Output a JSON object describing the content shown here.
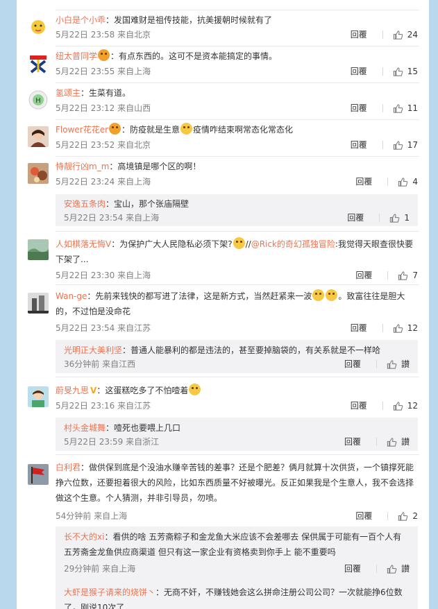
{
  "reply_label": "回覆",
  "comments": [
    {
      "user": "小白是个小乖",
      "text": "：发国难财是祖传技能，抗美援朝时候就有了",
      "time": "5月22日 23:58 来自北京",
      "likes": "24"
    },
    {
      "user": "纽太普同学",
      "text": "：有点东西的。这可不是资本能搞定的事情。",
      "time": "5月22日 23:55 来自上海",
      "likes": "15"
    },
    {
      "user": "氢颂主",
      "text": "：生菜有道。",
      "time": "5月22日 23:12 来自山西",
      "likes": "11"
    },
    {
      "user": "Flower花花er",
      "text_a": "：防疫就是生意",
      "text_b": "疫情咋结束啊常态化常态化",
      "time": "5月22日 23:52 来自北京",
      "likes": "17"
    },
    {
      "user": "恃靓行凶m_m",
      "text": "：高境镇是哪个区的啊！",
      "time": "5月22日 23:24 来自上海",
      "likes": "4",
      "reply": {
        "user": "安逸五条肉",
        "text": "：宝山，那个张庙隔壁",
        "time": "5月22日 23:54 来自上海",
        "likes": "1"
      }
    },
    {
      "user": "人如棋落无悔V",
      "text_a": "：为保护广大人民隐私必须下架?",
      "text_b": "//",
      "mention": "@Rick的奇幻孤独冒险",
      "text_c": ":我觉得天眼查很快要下架了...",
      "time": "5月22日 23:30 来自上海",
      "likes": "7"
    },
    {
      "user": "Wan-ge",
      "text_a": "：先前来钱快的都写进了法律，这是新方式，当然赶紧来一波",
      "text_b": "。致富往往是胆大的，不过怕是没命花",
      "time": "5月22日 23:54 来自江苏",
      "likes": "12",
      "reply": {
        "user": "光明正大美利坚",
        "text": "：普通人能暴利的都是违法的，甚至要掉脑袋的，有关系就是不一样哈",
        "time": "36分钟前 来自江西",
        "likes": "讃"
      }
    },
    {
      "user": "蔚旻九思",
      "badge": "V",
      "text": "：这蛋糕吃多了不怕噎着",
      "time": "5月22日 23:16 来自江苏",
      "likes": "12",
      "reply": {
        "user": "村头金城舞",
        "text": "：噎死也要喂上几口",
        "time": "5月22日 23:59 来自浙江",
        "likes": "讃"
      }
    },
    {
      "user": "白利君",
      "text": "：做供保到底是个没油水赚辛苦钱的差事？还是个肥差？俩月就算十次供货，一个镇撑死能挣六位数，还要担着很大的风险，比如东西质量不好被曝光。反正如果我是个生意人，我不会选择做这个生意。个人猜测，并非引导员，勿喷。",
      "time": "54分钟前 来自上海",
      "likes": "2",
      "replies": [
        {
          "user": "长不大的xi",
          "text": "：看供的啥 五芳斋粽子和金龙鱼大米应该不会差哪去 保供属于可能有一百个人有五芳斋金龙鱼供应商渠道 但只有这一家企业有资格卖到你手上 能不重要吗",
          "time": "29分钟前 来自上海",
          "likes": "讃"
        },
        {
          "user": "大虾是猴子请来的烧饼丶",
          "text": "：无商不奸，不赚钱她会这么拼命注册公司公司？一次就能挣6位数了，刚说10次了",
          "time": "",
          "likes": ""
        }
      ]
    }
  ]
}
